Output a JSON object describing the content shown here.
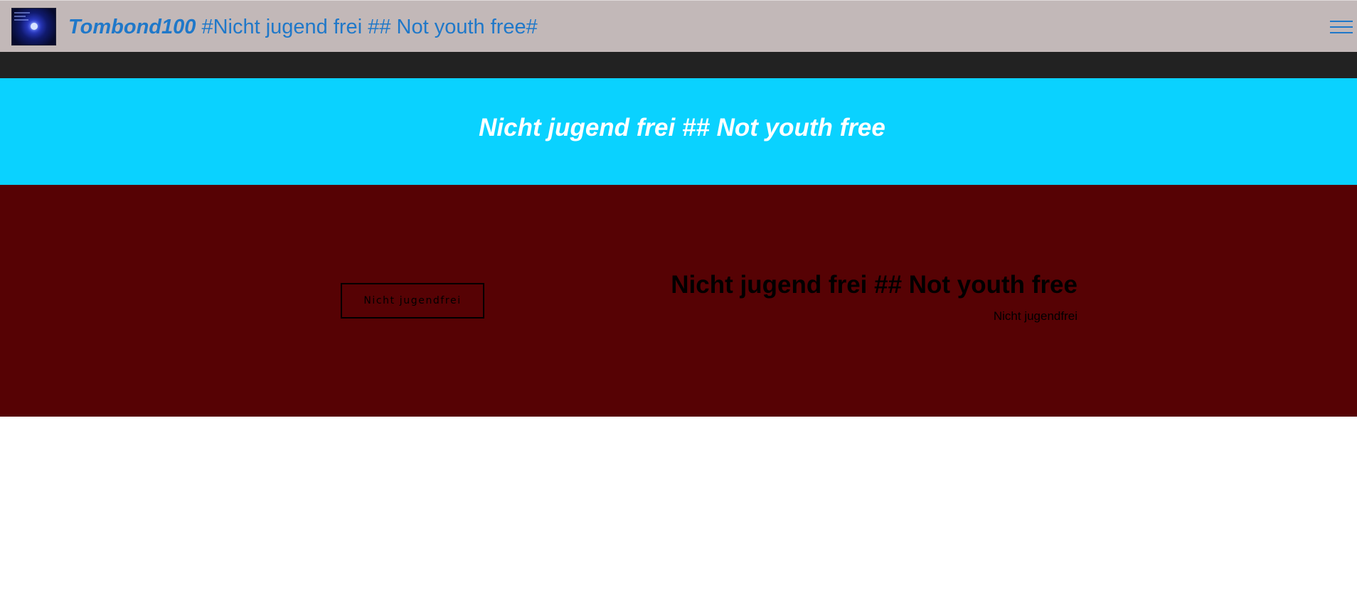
{
  "header": {
    "logo_icon": "moonlit-night-icon",
    "brand_strong": "Tombond100",
    "brand_rest": " #Nicht jugend frei ## Not youth free#",
    "menu_icon": "hamburger-menu-icon",
    "colors": {
      "background": "#c2b8b8",
      "brand_text": "#1f78c9"
    }
  },
  "hero": {
    "title": "Nicht jugend frei ## Not youth free",
    "background": "#0ad2ff"
  },
  "content": {
    "background": "#560204",
    "button_label": "Nicht jugendfrei",
    "title": "Nicht jugend frei ## Not youth free",
    "subtitle": "Nicht jugendfrei"
  }
}
